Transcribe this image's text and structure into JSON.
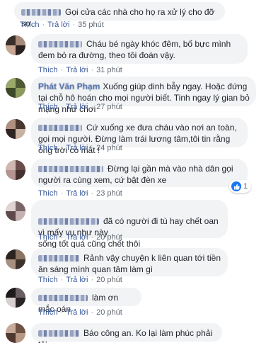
{
  "action_labels": {
    "like": "Thích",
    "reply": "Trả lời",
    "separator": "·"
  },
  "comments": [
    {
      "author": "",
      "text": "Gọi cửa các nhà cho họ ra xử lý cho đỡ sợ",
      "time": "35 phút"
    },
    {
      "author": "",
      "text": "Cháu bé ngày khóc đêm, bố bực mình đem bỏ ra đường, theo tôi đoán vậy.",
      "time": "31 phút"
    },
    {
      "author": "Phát Văn Phạm",
      "text": "Xuống giúp dinh bẫy ngay. Hoặc đứng tại chỗ hô hoán cho mọi người biết. Tinh ngay lý gian bỏ mạng như chơi",
      "time": "27 phút"
    },
    {
      "author": "",
      "text": "Cứ xuống xe đưa cháu vào nơi an toàn, gọi mọi người. Đừng làm trái lương tâm,tôi tin rằng ông trời có mắt !",
      "time": "24 phút"
    },
    {
      "author": "",
      "text": "Đừng lại gần mà vào nhà dân gọi người ra cùng xem, cứ bật đèn xe",
      "time": "23 phút",
      "reaction_count": "1"
    },
    {
      "author": "",
      "text": "đã có người đi tù hay chết oan vì mấy vụ như này\nsống tốt quá cũng chết thôi",
      "time": "20 phút"
    },
    {
      "author": "",
      "text": "Rảnh vậy chuyện k liên quan tới tiền ăn sáng mình quan tâm làm gì",
      "time": "20 phút"
    },
    {
      "author": "",
      "text": "làm ơn mắc oán",
      "time": "20 phút"
    },
    {
      "author": "",
      "text": "Báo công an. Ko lại làm phúc phải tội",
      "time": ""
    }
  ],
  "colors": {
    "link": "#385898",
    "bubble": "#f2f3f5",
    "meta": "#606770",
    "like_blue": "#1877f2"
  }
}
